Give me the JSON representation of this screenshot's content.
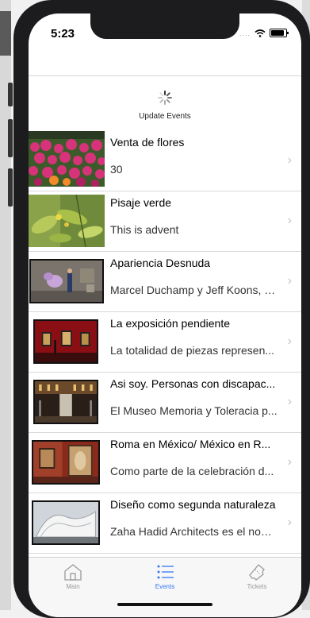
{
  "status": {
    "time": "5:23",
    "signal_dots": "....",
    "wifi_icon": "wifi-icon",
    "battery_icon": "battery-icon"
  },
  "refresh": {
    "label": "Update Events",
    "icon": "spinner-icon"
  },
  "events": [
    {
      "title": "Venta de flores",
      "subtitle": "30",
      "image": "photo-flowers"
    },
    {
      "title": "Pisaje verde",
      "subtitle": "This is advent",
      "image": "photo-leaves"
    },
    {
      "title": "Apariencia Desnuda",
      "subtitle": "Marcel Duchamp y Jeff Koons, un...",
      "image": "photo-gallery-balloon"
    },
    {
      "title": "La exposición pendiente",
      "subtitle": "La totalidad de piezas represen...",
      "image": "photo-red-gallery"
    },
    {
      "title": "Asi soy. Personas con discapac...",
      "subtitle": "El Museo Memoria y Toleracia p...",
      "image": "photo-hall"
    },
    {
      "title": "Roma en México/ México en R...",
      "subtitle": "Como parte de la celebración d...",
      "image": "photo-painting-room"
    },
    {
      "title": "Diseño como segunda naturaleza",
      "subtitle": "Zaha Hadid Architects es el nom...",
      "image": "photo-architecture"
    }
  ],
  "tabs": [
    {
      "label": "Main",
      "icon": "home-icon",
      "active": false
    },
    {
      "label": "Events",
      "icon": "list-icon",
      "active": true
    },
    {
      "label": "Tickets",
      "icon": "ticket-icon",
      "active": false
    }
  ],
  "colors": {
    "accent": "#3478f6",
    "inactive": "#9a9a9a"
  }
}
